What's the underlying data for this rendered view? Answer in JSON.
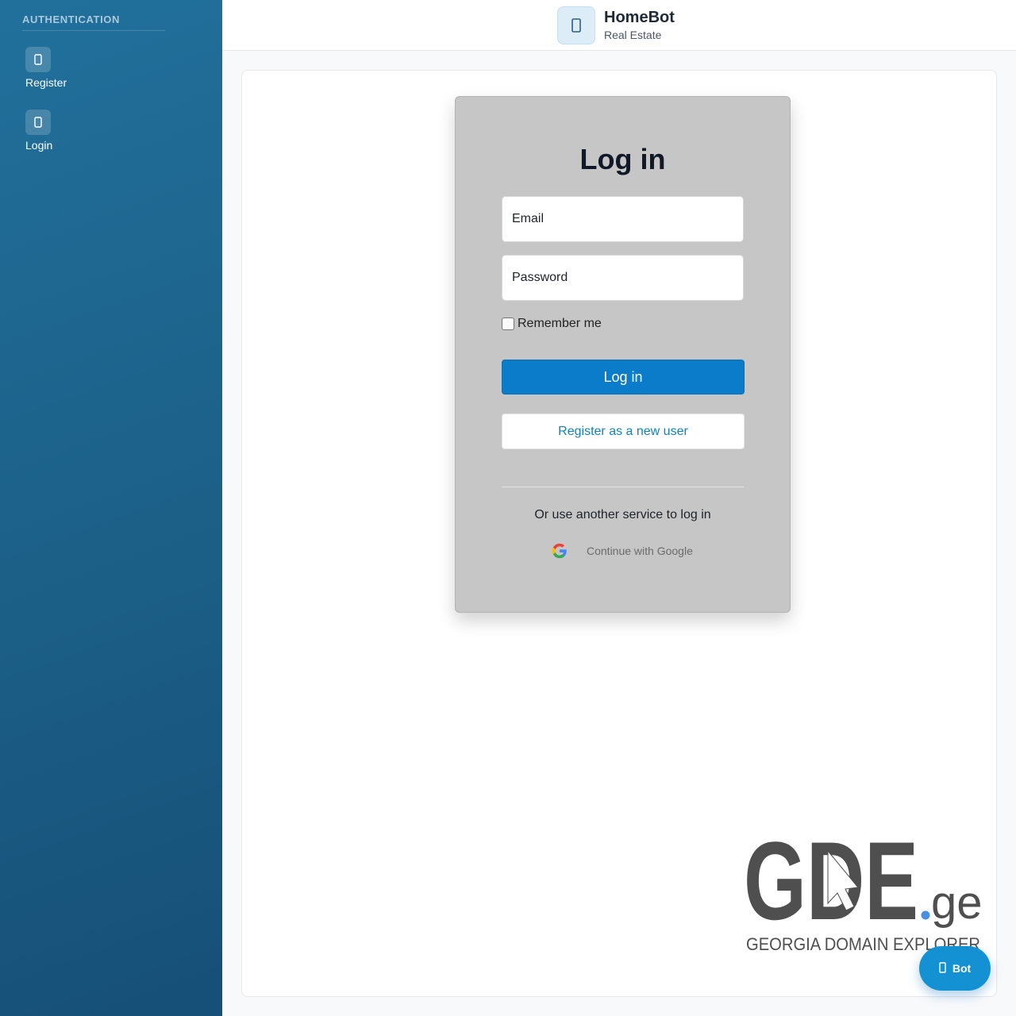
{
  "sidebar": {
    "heading": "AUTHENTICATION",
    "items": [
      {
        "label": "Register",
        "icon": "user-plus-icon"
      },
      {
        "label": "Login",
        "icon": "sign-in-icon"
      }
    ]
  },
  "header": {
    "brand_name": "HomeBot",
    "brand_sub": "Real Estate",
    "brand_icon": "home-icon"
  },
  "login": {
    "title": "Log in",
    "email_placeholder": "Email",
    "password_placeholder": "Password",
    "remember_label": "Remember me",
    "remember_checked": false,
    "submit_label": "Log in",
    "register_label": "Register as a new user",
    "alt_text": "Or use another service to log in",
    "google_label": "Continue with Google"
  },
  "watermark": {
    "logo_text": "GDE",
    "logo_tld": ".ge",
    "tagline": "GEORGIA DOMAIN EXPLORER"
  },
  "bot": {
    "label": "Bot",
    "icon": "robot-icon"
  },
  "colors": {
    "sidebar": "#1c6189",
    "primary": "#0a7cc9",
    "link": "#1283bc",
    "card": "#c6c6c6",
    "bot": "#1491d3"
  }
}
